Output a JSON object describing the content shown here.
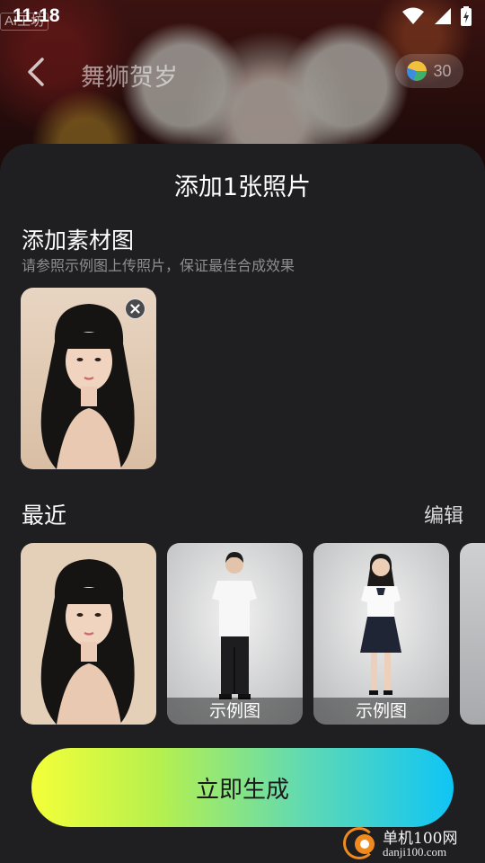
{
  "status_bar": {
    "time": "11:18"
  },
  "watermark_tag": "AI工坊",
  "nav": {
    "title": "舞狮贺岁",
    "coins": "30"
  },
  "sheet": {
    "title": "添加1张照片",
    "material": {
      "title": "添加素材图",
      "hint": "请参照示例图上传照片，保证最佳合成效果"
    },
    "recent": {
      "title": "最近",
      "edit_label": "编辑",
      "items": [
        {
          "caption": ""
        },
        {
          "caption": "示例图"
        },
        {
          "caption": "示例图"
        }
      ]
    },
    "generate_label": "立即生成"
  },
  "brand": {
    "name": "单机100网",
    "url": "danji100.com"
  },
  "colors": {
    "gradient_start": "#f4ff39",
    "gradient_end": "#0fc5f5",
    "sheet_bg": "#1f1f21"
  },
  "icons": {
    "back": "chevron-left-icon",
    "remove": "close-icon",
    "coin": "coin-icon"
  }
}
